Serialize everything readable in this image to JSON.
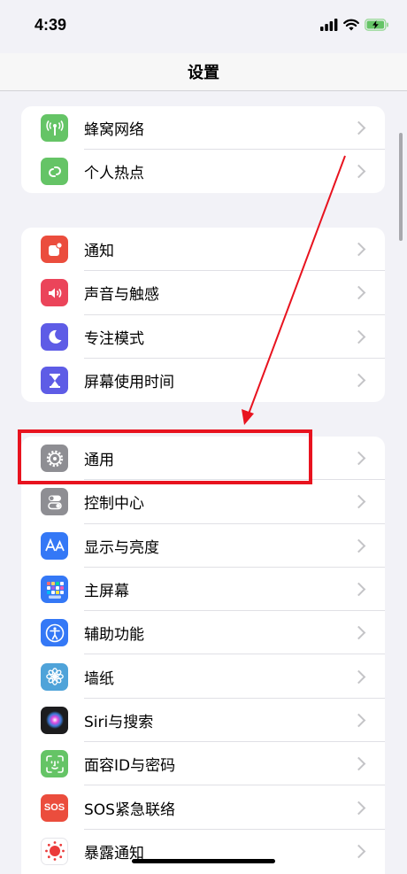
{
  "status": {
    "time": "4:39"
  },
  "nav": {
    "title": "设置"
  },
  "groups": [
    {
      "items": [
        {
          "label": "蜂窝网络",
          "icon": "cellular-antenna-icon",
          "color": "#65c466"
        },
        {
          "label": "个人热点",
          "icon": "personal-hotspot-link-icon",
          "color": "#65c466"
        }
      ]
    },
    {
      "items": [
        {
          "label": "通知",
          "icon": "notification-bell-icon",
          "color": "#eb4d3d"
        },
        {
          "label": "声音与触感",
          "icon": "speaker-icon",
          "color": "#eb445a"
        },
        {
          "label": "专注模式",
          "icon": "moon-icon",
          "color": "#5e5ce6"
        },
        {
          "label": "屏幕使用时间",
          "icon": "hourglass-icon",
          "color": "#5e5ce6"
        }
      ]
    },
    {
      "items": [
        {
          "label": "通用",
          "icon": "gear-icon",
          "color": "#8e8e93"
        },
        {
          "label": "控制中心",
          "icon": "toggle-switches-icon",
          "color": "#8e8e93"
        },
        {
          "label": "显示与亮度",
          "icon": "text-size-aa-icon",
          "color": "#3478f6"
        },
        {
          "label": "主屏幕",
          "icon": "app-grid-icon",
          "color": "#3478f6"
        },
        {
          "label": "辅助功能",
          "icon": "accessibility-person-icon",
          "color": "#3478f6"
        },
        {
          "label": "墙纸",
          "icon": "flower-icon",
          "color": "#4fa3d9"
        },
        {
          "label": "Siri与搜索",
          "icon": "siri-orb-icon",
          "color": "#1c1c1e"
        },
        {
          "label": "面容ID与密码",
          "icon": "face-id-icon",
          "color": "#65c466"
        },
        {
          "label": "SOS紧急联络",
          "icon": "sos-icon",
          "color": "#eb4d3d"
        },
        {
          "label": "暴露通知",
          "icon": "exposure-dots-icon",
          "color": "#ffffff"
        }
      ]
    }
  ],
  "sos_icon_text": "SOS",
  "annotation": {
    "highlight_color": "#e8131f"
  }
}
